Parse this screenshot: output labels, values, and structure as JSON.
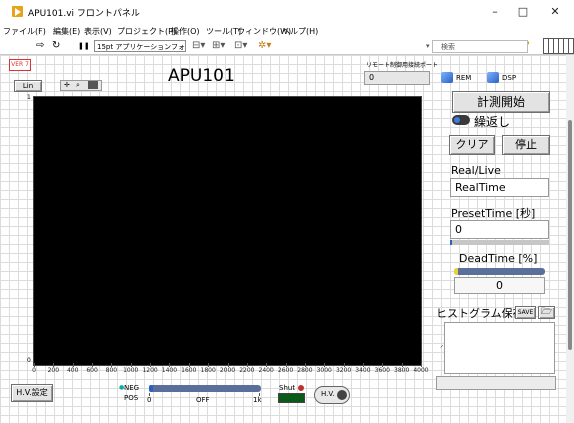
{
  "window": {
    "title": "APU101.vi フロントパネル",
    "minimize": "–",
    "maximize": "□",
    "close": "✕"
  },
  "menu": [
    "ファイル(F)",
    "編集(E)",
    "表示(V)",
    "プロジェクト(P)",
    "操作(O)",
    "ツール(T)",
    "ウィンドウ(W)",
    "ヘルプ(H)"
  ],
  "toolbar": {
    "run_arrow": "⇨",
    "run_continuous": "↻",
    "pause": "❚❚",
    "font": "15pt アプリケーションフォント",
    "search_placeholder": "検索"
  },
  "panel": {
    "version_label": "VER 7",
    "scale_button": "Lin",
    "title": "APU101",
    "remote_port_label": "リモート制御用接続ポート",
    "remote_port_value": "0",
    "rem_label": "REM",
    "dsp_label": "DSP",
    "y_axis_top": "1",
    "y_axis_bottom": "0",
    "x_ticks": [
      "0",
      "200",
      "400",
      "600",
      "800",
      "1000",
      "1200",
      "1400",
      "1600",
      "1800",
      "2000",
      "2200",
      "2400",
      "2600",
      "2800",
      "3000",
      "3200",
      "3400",
      "3600",
      "3800",
      "4000"
    ],
    "start_button": "計測開始",
    "repeat_label": "繰返し",
    "clear_button": "クリア",
    "stop_button": "停止",
    "realive_label": "Real/Live",
    "realive_value": "RealTime",
    "preset_label": "PresetTime [秒]",
    "preset_value": "0",
    "deadtime_label": "DeadTime [%]",
    "deadtime_value": "0",
    "histogram_label": "ヒストグラム保存",
    "save_button": "SAVE",
    "folder_icon": "folder-icon",
    "hv_settings_button": "H.V.設定",
    "neg_label": "NEG",
    "pos_label": "POS",
    "slider_min": "0",
    "slider_mid": "OFF",
    "slider_max": "1k",
    "shut_label": "Shut",
    "hv_button": "H.V."
  },
  "colors": {
    "panel_bg": "#f0f0f0",
    "plot_bg": "#000000",
    "accent_blue": "#3060c0",
    "led_green": "#1fa31f"
  }
}
